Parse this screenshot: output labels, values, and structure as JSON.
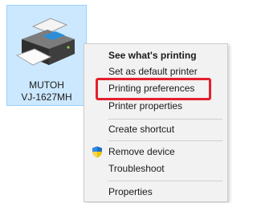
{
  "device": {
    "name_line1": "MUTOH",
    "name_line2": "VJ-1627MH",
    "icon": "printer-icon"
  },
  "context_menu": {
    "items": [
      {
        "label": "See what's printing",
        "bold": true
      },
      {
        "label": "Set as default printer"
      },
      {
        "label": "Printing preferences",
        "highlighted": true
      },
      {
        "label": "Printer properties"
      },
      {
        "label": "Create shortcut"
      },
      {
        "label": "Remove device",
        "icon": "shield-icon"
      },
      {
        "label": "Troubleshoot"
      },
      {
        "label": "Properties"
      }
    ]
  },
  "colors": {
    "selection_fill": "#cce8ff",
    "highlight_border": "#e3202e",
    "menu_background": "#f2f2f2"
  }
}
